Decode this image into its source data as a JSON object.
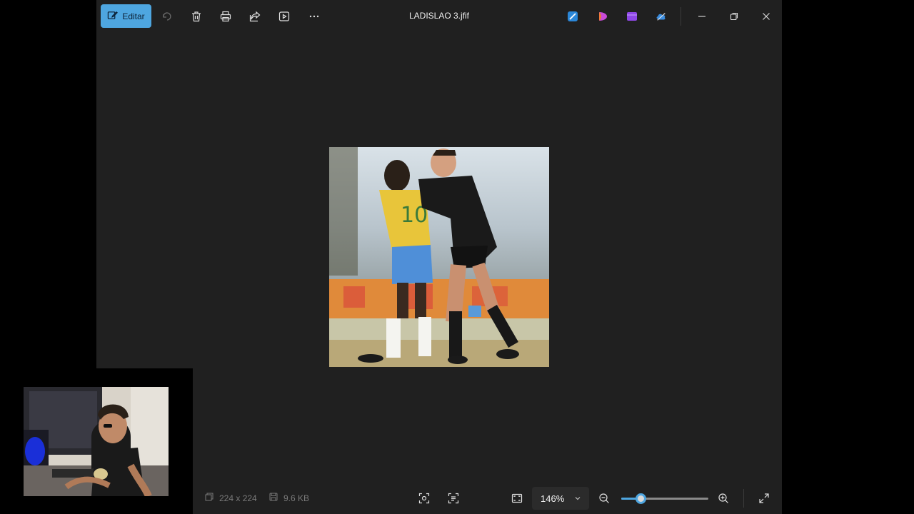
{
  "toolbar": {
    "edit_label": "Editar",
    "title": "LADISLAO 3.jfif",
    "icons": [
      "edit-icon",
      "rotate-icon",
      "delete-icon",
      "print-icon",
      "share-icon",
      "slideshow-icon",
      "more-icon"
    ],
    "app_icons": [
      "designer-icon",
      "clipchamp-icon",
      "video-editor-icon",
      "onedrive-icon"
    ],
    "window_controls": [
      "minimize-icon",
      "restore-icon",
      "close-icon"
    ]
  },
  "statusbar": {
    "dimensions": "224 x 224",
    "file_size": "9.6 KB",
    "zoom": "146%",
    "zoom_fraction": 0.22
  },
  "colors": {
    "accent": "#4ea6e0",
    "background": "#202020"
  }
}
